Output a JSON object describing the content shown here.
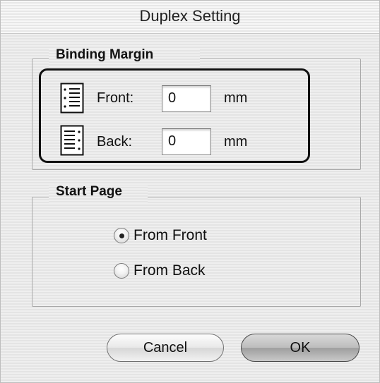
{
  "dialog": {
    "title": "Duplex Setting"
  },
  "binding_margin": {
    "legend": "Binding Margin",
    "front": {
      "label": "Front:",
      "value": "0",
      "unit": "mm",
      "icon": "left-binding-icon"
    },
    "back": {
      "label": "Back:",
      "value": "0",
      "unit": "mm",
      "icon": "right-binding-icon"
    }
  },
  "start_page": {
    "legend": "Start Page",
    "options": [
      {
        "label": "From Front",
        "selected": true
      },
      {
        "label": "From Back",
        "selected": false
      }
    ]
  },
  "buttons": {
    "cancel": "Cancel",
    "ok": "OK"
  }
}
